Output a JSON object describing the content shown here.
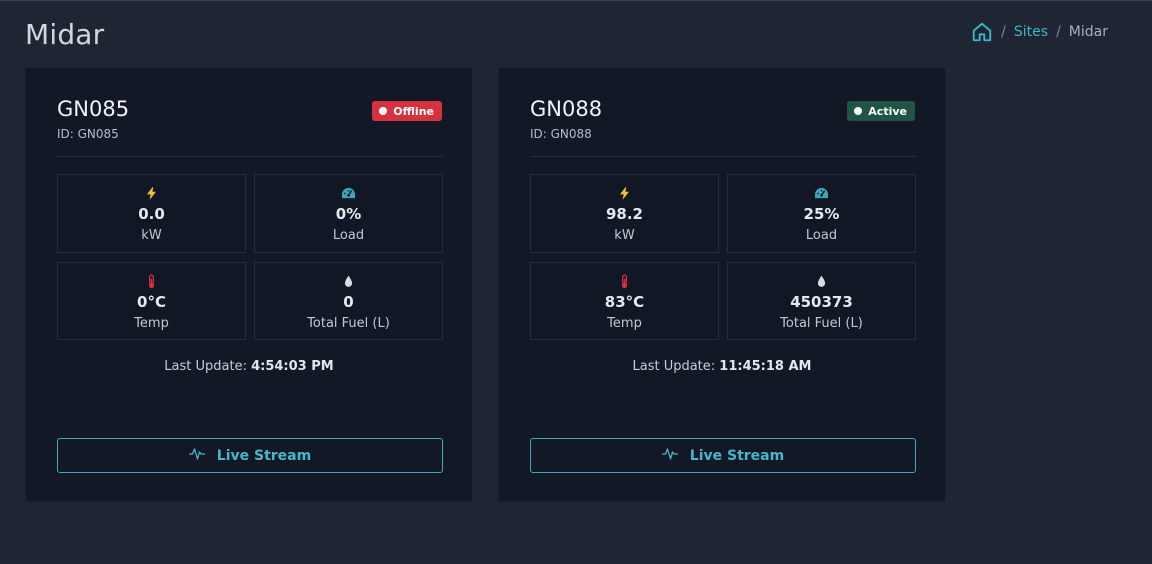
{
  "page": {
    "title": "Midar"
  },
  "breadcrumb": {
    "home_icon": "home-icon",
    "sites": "Sites",
    "current": "Midar",
    "separator": "/"
  },
  "colors": {
    "accent": "#3fb5c8",
    "offline": "#d5313f",
    "active": "#1f5544",
    "bolt": "#f2c230",
    "gauge": "#3fa6b8",
    "thermo": "#e0303e",
    "drop": "#d9dde3"
  },
  "cards": [
    {
      "name": "GN085",
      "id_text": "ID: GN085",
      "status": "Offline",
      "metrics": {
        "power": {
          "icon": "bolt-icon",
          "value": "0.0",
          "label": "kW"
        },
        "load": {
          "icon": "gauge-icon",
          "value": "0%",
          "label": "Load"
        },
        "temp": {
          "icon": "thermometer-icon",
          "value": "0°C",
          "label": "Temp"
        },
        "fuel": {
          "icon": "droplet-icon",
          "value": "0",
          "label": "Total Fuel (L)"
        }
      },
      "last_update_label": "Last Update:",
      "last_update_time": "4:54:03 PM",
      "live_stream": {
        "icon": "activity-icon",
        "label": "Live Stream"
      }
    },
    {
      "name": "GN088",
      "id_text": "ID: GN088",
      "status": "Active",
      "metrics": {
        "power": {
          "icon": "bolt-icon",
          "value": "98.2",
          "label": "kW"
        },
        "load": {
          "icon": "gauge-icon",
          "value": "25%",
          "label": "Load"
        },
        "temp": {
          "icon": "thermometer-icon",
          "value": "83°C",
          "label": "Temp"
        },
        "fuel": {
          "icon": "droplet-icon",
          "value": "450373",
          "label": "Total Fuel (L)"
        }
      },
      "last_update_label": "Last Update:",
      "last_update_time": "11:45:18 AM",
      "live_stream": {
        "icon": "activity-icon",
        "label": "Live Stream"
      }
    }
  ]
}
